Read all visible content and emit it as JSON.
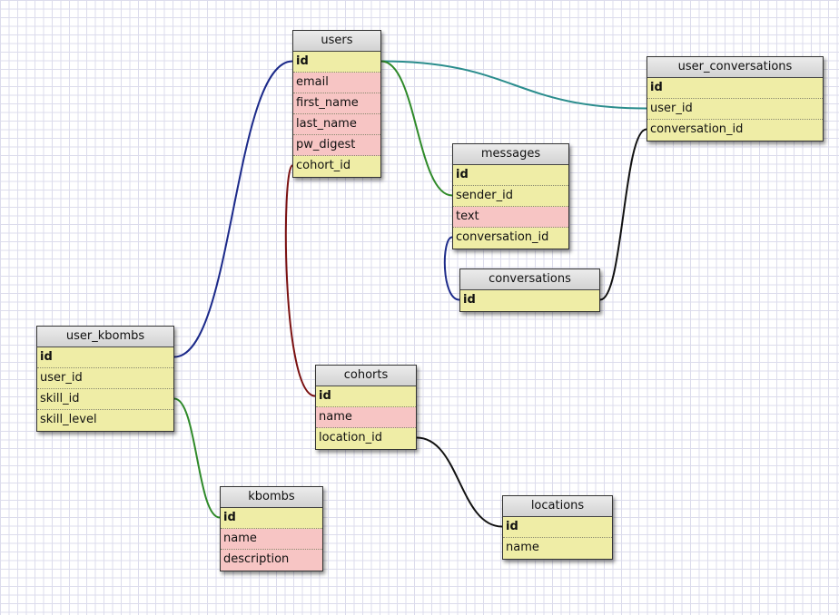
{
  "colors": {
    "key_row": "#efeda6",
    "attr_row": "#f7c5c4",
    "link_navy": "#1c2a8a",
    "link_green": "#2f8a2a",
    "link_teal": "#2b8d8d",
    "link_dark_red": "#7a1010",
    "link_black": "#111111"
  },
  "tables": [
    {
      "key": "users",
      "title": "users",
      "rows": [
        {
          "label": "id",
          "kind": "pk"
        },
        {
          "label": "email",
          "kind": "attr"
        },
        {
          "label": "first_name",
          "kind": "attr"
        },
        {
          "label": "last_name",
          "kind": "attr"
        },
        {
          "label": "pw_digest",
          "kind": "attr"
        },
        {
          "label": "cohort_id",
          "kind": "fk"
        }
      ]
    },
    {
      "key": "user_conversations",
      "title": "user_conversations",
      "rows": [
        {
          "label": "id",
          "kind": "pk"
        },
        {
          "label": "user_id",
          "kind": "fk"
        },
        {
          "label": "conversation_id",
          "kind": "fk"
        }
      ]
    },
    {
      "key": "messages",
      "title": "messages",
      "rows": [
        {
          "label": "id",
          "kind": "pk"
        },
        {
          "label": "sender_id",
          "kind": "fk"
        },
        {
          "label": "text",
          "kind": "attr"
        },
        {
          "label": "conversation_id",
          "kind": "fk"
        }
      ]
    },
    {
      "key": "conversations",
      "title": "conversations",
      "rows": [
        {
          "label": "id",
          "kind": "pk"
        }
      ]
    },
    {
      "key": "user_kbombs",
      "title": "user_kbombs",
      "rows": [
        {
          "label": "id",
          "kind": "pk"
        },
        {
          "label": "user_id",
          "kind": "fk"
        },
        {
          "label": "skill_id",
          "kind": "fk"
        },
        {
          "label": "skill_level",
          "kind": "fk"
        }
      ]
    },
    {
      "key": "cohorts",
      "title": "cohorts",
      "rows": [
        {
          "label": "id",
          "kind": "pk"
        },
        {
          "label": "name",
          "kind": "attr"
        },
        {
          "label": "location_id",
          "kind": "fk"
        }
      ]
    },
    {
      "key": "kbombs",
      "title": "kbombs",
      "rows": [
        {
          "label": "id",
          "kind": "pk"
        },
        {
          "label": "name",
          "kind": "attr"
        },
        {
          "label": "description",
          "kind": "attr"
        }
      ]
    },
    {
      "key": "locations",
      "title": "locations",
      "rows": [
        {
          "label": "id",
          "kind": "pk"
        },
        {
          "label": "name",
          "kind": "fk"
        }
      ]
    }
  ],
  "relations": [
    {
      "from": "users.id",
      "to": "user_conversations.user_id",
      "color": "link_teal"
    },
    {
      "from": "users.id",
      "to": "messages.sender_id",
      "color": "link_green"
    },
    {
      "from": "users.id",
      "to": "user_kbombs.id",
      "color": "link_navy"
    },
    {
      "from": "users.cohort_id",
      "to": "cohorts.id",
      "color": "link_dark_red"
    },
    {
      "from": "messages.conversation_id",
      "to": "conversations.id",
      "color": "link_navy"
    },
    {
      "from": "conversations.id",
      "to": "user_conversations.conversation_id",
      "color": "link_black"
    },
    {
      "from": "user_kbombs.skill_id",
      "to": "kbombs.id",
      "color": "link_green"
    },
    {
      "from": "cohorts.location_id",
      "to": "locations.id",
      "color": "link_black"
    }
  ]
}
